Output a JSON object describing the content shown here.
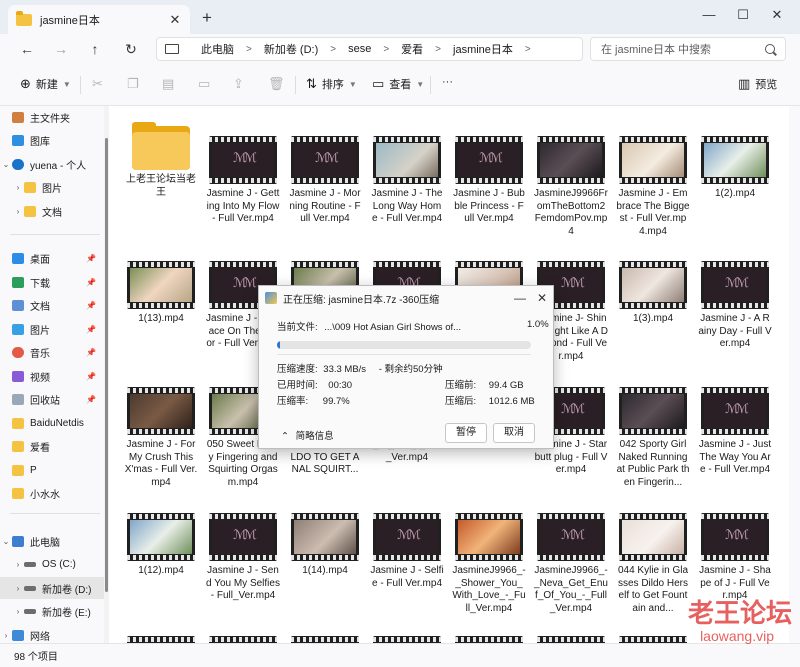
{
  "window": {
    "tab_title": "jasmine日本",
    "new_tab": "+",
    "minimize": "—",
    "maximize": "☐",
    "close": "✕"
  },
  "nav": {
    "back": "←",
    "forward": "→",
    "up": "↑",
    "refresh": "↻",
    "breadcrumb": [
      "此电脑",
      "新加卷 (D:)",
      "sese",
      "爱看",
      "jasmine日本"
    ],
    "search_placeholder": "在 jasmine日本 中搜索"
  },
  "toolbar": {
    "new_label": "新建",
    "sort_label": "排序",
    "view_label": "查看",
    "more_label": "···",
    "preview_label": "预览"
  },
  "sidebar": {
    "items": [
      {
        "label": "主文件夹",
        "icon": "home-icon"
      },
      {
        "label": "图库",
        "icon": "gallery-icon"
      },
      {
        "label": "yuena - 个人",
        "icon": "onedrive-icon"
      },
      {
        "label": "图片",
        "icon": "folder-icon"
      },
      {
        "label": "文档",
        "icon": "folder-icon"
      },
      {
        "label": "桌面",
        "icon": "desktop-icon"
      },
      {
        "label": "下载",
        "icon": "download-icon"
      },
      {
        "label": "文档",
        "icon": "documents-icon"
      },
      {
        "label": "图片",
        "icon": "pictures-icon"
      },
      {
        "label": "音乐",
        "icon": "music-icon"
      },
      {
        "label": "视频",
        "icon": "videos-icon"
      },
      {
        "label": "回收站",
        "icon": "recycle-bin-icon"
      },
      {
        "label": "BaiduNetdis",
        "icon": "folder-icon"
      },
      {
        "label": "爱看",
        "icon": "folder-icon"
      },
      {
        "label": "P",
        "icon": "folder-icon"
      },
      {
        "label": "小水水",
        "icon": "folder-icon"
      },
      {
        "label": "此电脑",
        "icon": "this-pc-icon"
      },
      {
        "label": "OS (C:)",
        "icon": "drive-icon"
      },
      {
        "label": "新加卷 (D:)",
        "icon": "drive-icon"
      },
      {
        "label": "新加卷 (E:)",
        "icon": "drive-icon"
      },
      {
        "label": "网络",
        "icon": "network-icon"
      }
    ]
  },
  "files": {
    "row1": [
      "上老王论坛当老王",
      "Jasmine J - Getting Into My Flow - Full Ver.mp4",
      "Jasmine J - Morning Routine - Full Ver.mp4",
      "Jasmine J - The Long Way Home - Full Ver.mp4",
      "Jasmine J - Bubble Princess - Full Ver.mp4",
      "JasmineJ9966FromTheBottom2FemdomPov.mp4",
      "Jasmine J - Embrace The Biggest - Full Ver.mp4.mp4",
      "1(2).mp4"
    ],
    "row2": [
      "1(13).mp4",
      "Jasmine J - Versace On The Floor - Full Ver.mp4",
      "",
      "",
      "",
      "Jasmine J- Shine Bright Like A Diamond - Full Ver.mp4",
      "1(3).mp4",
      "Jasmine J - A Rainy Day - Full Ver.mp4"
    ],
    "row3": [
      "Jasmine J - For My Crush This X'mas - Full Ver.mp4",
      "050 Sweet Pussy Fingering and Squirting Orgasm.mp4",
      "GIRL USING DILDO TO GET ANAL SQUIRT...",
      "_its_You_-_Full_Ver.mp4",
      "Jasmine J - Starbutt plug - Full Ver.mp4",
      "042 Sporty Girl Naked Running at Public Park then Fingerin...",
      "Jasmine J - Just The Way You Are - Full Ver.mp4"
    ],
    "row4": [
      "1(12).mp4",
      "Jasmine J - Send You My Selfies - Full_Ver.mp4",
      "1(14).mp4",
      "Jasmine J - Selfie - Full Ver.mp4",
      "JasmineJ9966_-_Shower_You_With_Love_-_Full_Ver.mp4",
      "JasmineJ9966_-_Neva_Get_Enuf_Of_You_-_Full_Ver.mp4",
      "044 Kylie in Glasses Dildo Herself to Get Fountain and...",
      "Jasmine J - Shape of J - Full Ver.mp4"
    ]
  },
  "status": {
    "count": "98 个项目"
  },
  "watermark": {
    "big": "老王论坛",
    "small": "laowang.vip"
  },
  "dialog": {
    "title": "正在压缩: jasmine日本.7z -360压缩",
    "current_label": "当前文件:",
    "current_file": "...\\009 Hot Asian Girl Shows of...",
    "percent": "1.0%",
    "progress_fraction": 0.01,
    "speed_label": "压缩速度:",
    "speed_value": "33.3 MB/s",
    "remaining": "- 剩余约50分钟",
    "elapsed_label": "已用时间:",
    "elapsed_value": "00:30",
    "before_label": "压缩前:",
    "before_value": "99.4 GB",
    "ratio_label": "压缩率:",
    "ratio_value": "99.7%",
    "after_label": "压缩后:",
    "after_value": "1012.6 MB",
    "details_label": "简略信息",
    "pause_label": "暂停",
    "cancel_label": "取消"
  }
}
